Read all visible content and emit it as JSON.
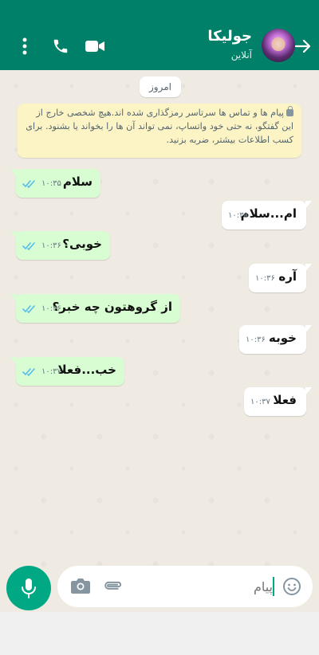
{
  "header": {
    "contact_name": "جولیکا",
    "status": "آنلاین",
    "background": "#008069"
  },
  "chat": {
    "date_label": "امروز",
    "encryption_notice": "پیام ها و تماس ها سرتاسر رمزگذاری شده اند.هیچ شخصی خارج از این گفتگو، نه حتی خود واتساپ، نمی تواند آن ها را بخواند یا بشنود. برای کسب اطلاعات بیشتر، ضربه بزنید.",
    "messages": [
      {
        "direction": "out",
        "text": "سلام",
        "time": "۱۰:۳۵",
        "read": true
      },
      {
        "direction": "in",
        "text": "ام...سلام",
        "time": "۱۰:۳۵"
      },
      {
        "direction": "out",
        "text": "خوبی؟",
        "time": "۱۰:۳۶",
        "read": true
      },
      {
        "direction": "in",
        "text": "آره",
        "time": "۱۰:۳۶"
      },
      {
        "direction": "out",
        "text": "از گروهتون چه خبر؟",
        "time": "۱۰:۳۶",
        "read": true
      },
      {
        "direction": "in",
        "text": "خوبه",
        "time": "۱۰:۳۶"
      },
      {
        "direction": "out",
        "text": "خب...فعلا",
        "time": "۱۰:۳۷",
        "read": true
      },
      {
        "direction": "in",
        "text": "فعلا",
        "time": "۱۰:۳۷"
      }
    ]
  },
  "composer": {
    "placeholder": "پیام",
    "accent": "#00a884"
  },
  "icons": [
    "back-arrow-icon",
    "video-call-icon",
    "phone-icon",
    "more-menu-icon",
    "mic-icon",
    "camera-icon",
    "attach-icon",
    "emoji-icon",
    "double-tick-icon",
    "lock-icon"
  ]
}
